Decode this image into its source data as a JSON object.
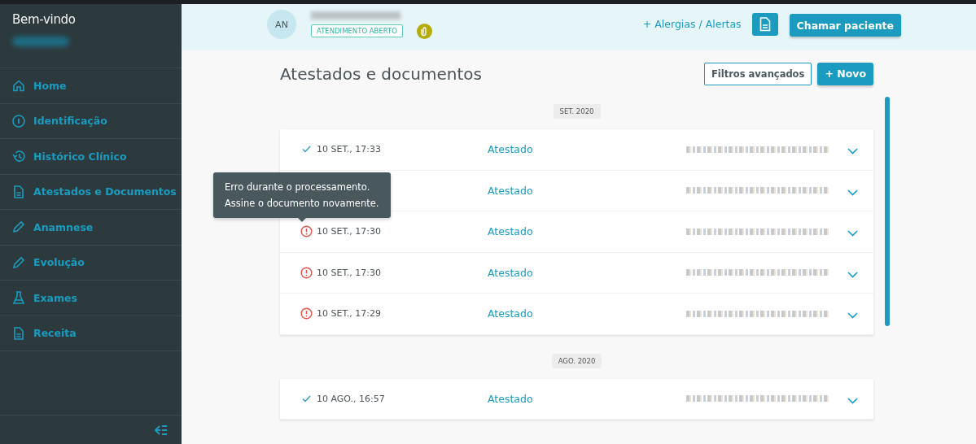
{
  "sidebar": {
    "title": "Bem-vindo",
    "items": [
      {
        "label": "Home",
        "selected": false
      },
      {
        "label": "Identificação",
        "selected": false
      },
      {
        "label": "Histórico Clínico",
        "selected": false
      },
      {
        "label": "Atestados e Documentos",
        "selected": false
      },
      {
        "label": "Anamnese",
        "selected": false
      },
      {
        "label": "Evolução",
        "selected": false
      },
      {
        "label": "Exames",
        "selected": false
      },
      {
        "label": "Receita",
        "selected": false
      }
    ]
  },
  "header": {
    "avatar": "AN",
    "badge": "ATENDIMENTO ABERTO",
    "alerts_link": "+ Alergias / Alertas",
    "call_button": "Chamar paciente"
  },
  "page": {
    "title": "Atestados e documentos",
    "filter_button": "Filtros avançados",
    "new_button": "+ Novo"
  },
  "groups": [
    {
      "month": "SET. 2020",
      "rows": [
        {
          "kind": "ok",
          "time": "10 SET., 17:33",
          "type": "Atestado"
        },
        {
          "type": "Atestado"
        },
        {
          "kind": "error",
          "time": "10 SET., 17:30",
          "type": "Atestado",
          "tooltip": [
            "Erro durante o processamento.",
            "Assine o documento novamente."
          ]
        },
        {
          "kind": "error",
          "time": "10 SET., 17:30",
          "type": "Atestado"
        },
        {
          "kind": "error",
          "time": "10 SET., 17:29",
          "type": "Atestado"
        }
      ]
    },
    {
      "month": "AGO. 2020",
      "rows": [
        {
          "kind": "ok",
          "time": "10 AGO., 16:57",
          "type": "Atestado"
        }
      ]
    }
  ]
}
